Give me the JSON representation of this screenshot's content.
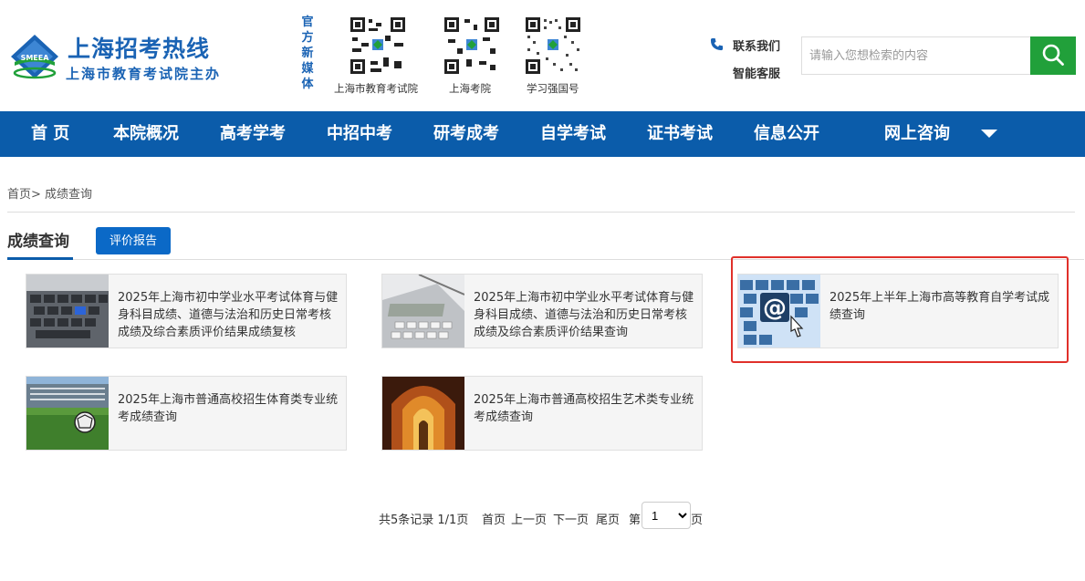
{
  "header": {
    "logo_title": "上海招考热线",
    "logo_subtitle": "上海市教育考试院主办",
    "logo_badge": "SMEEA",
    "media_label": "官方新媒体",
    "qr_codes": [
      {
        "caption": "上海市教育考试院"
      },
      {
        "caption": "上海考院"
      },
      {
        "caption": "学习强国号"
      }
    ],
    "contact_label": "联系我们",
    "service_label": "智能客服",
    "search_placeholder": "请输入您想检索的内容"
  },
  "nav": {
    "items": [
      "首 页",
      "本院概况",
      "高考学考",
      "中招中考",
      "研考成考",
      "自学考试",
      "证书考试",
      "信息公开",
      "网上咨询"
    ]
  },
  "breadcrumb": {
    "home": "首页>",
    "current": "成绩查询"
  },
  "section": {
    "title": "成绩查询",
    "report_button": "评价报告"
  },
  "cards": [
    {
      "text": "2025年上海市初中学业水平考试体育与健身科目成绩、道德与法治和历史日常考核成绩及综合素质评价结果成绩复核"
    },
    {
      "text": "2025年上海市初中学业水平考试体育与健身科目成绩、道德与法治和历史日常考核成绩及综合素质评价结果查询"
    },
    {
      "text": "2025年上半年上海市高等教育自学考试成绩查询"
    },
    {
      "text": "2025年上海市普通高校招生体育类专业统考成绩查询"
    },
    {
      "text": "2025年上海市普通高校招生艺术类专业统考成绩查询"
    }
  ],
  "pager": {
    "summary": "共5条记录 1/1页",
    "first": "首页",
    "prev": "上一页",
    "next": "下一页",
    "last": "尾页",
    "goto_prefix": "第",
    "goto_suffix": "页",
    "page_value": "1"
  },
  "colors": {
    "brand_blue": "#0b5caa",
    "search_green": "#21a03a",
    "highlight_red": "#e0302a"
  }
}
